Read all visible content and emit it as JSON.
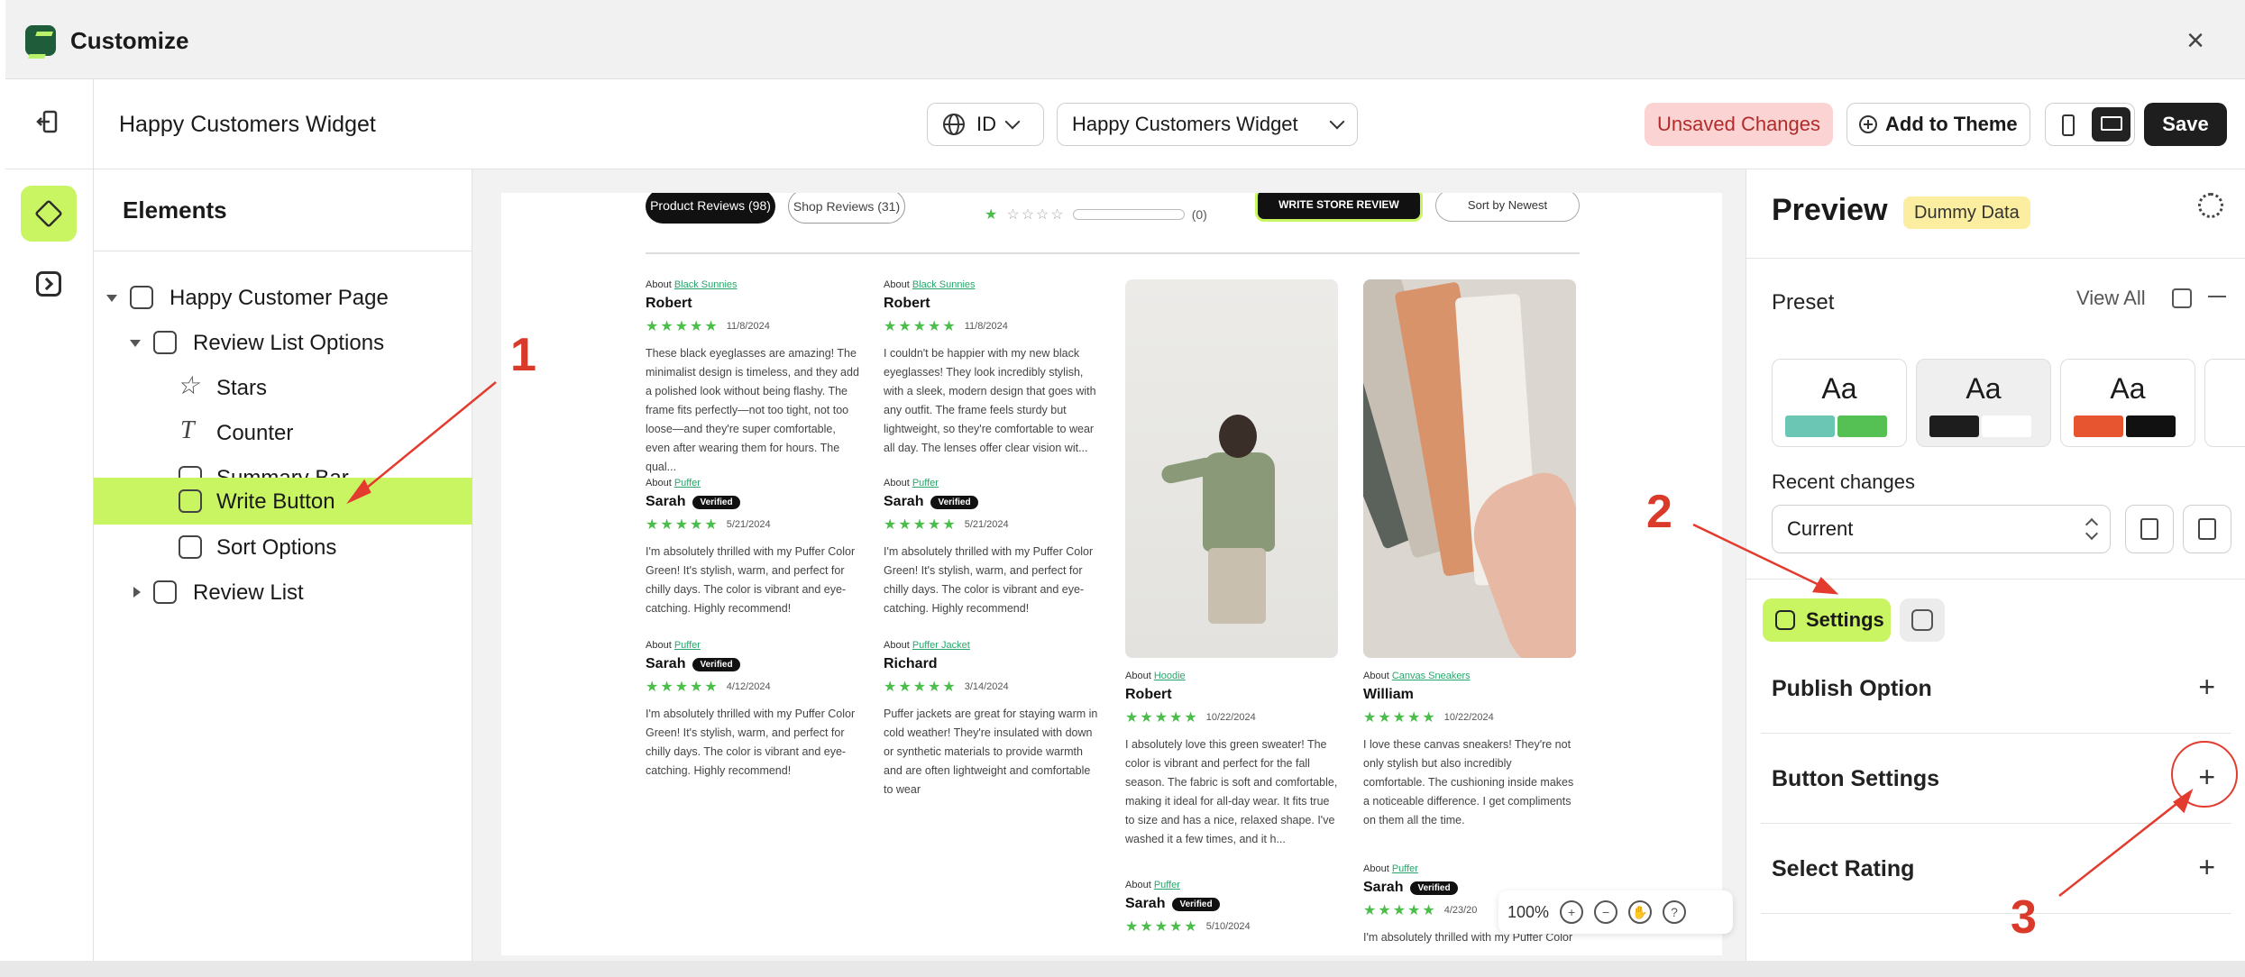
{
  "window": {
    "title": "Customize"
  },
  "header": {
    "page_name": "Happy Customers Widget",
    "language": "ID",
    "widget_select": "Happy Customers Widget",
    "unsaved": "Unsaved Changes",
    "add_to_theme": "Add to Theme",
    "save": "Save"
  },
  "elements": {
    "title": "Elements",
    "tree": [
      {
        "label": "Happy Customer Page"
      },
      {
        "label": "Review List Options"
      },
      {
        "label": "Stars"
      },
      {
        "label": "Counter"
      },
      {
        "label": "Summary Bar"
      },
      {
        "label": "Write Button"
      },
      {
        "label": "Sort Options"
      },
      {
        "label": "Review List"
      }
    ]
  },
  "preview_page": {
    "tab_product": "Product Reviews (98)",
    "tab_shop": "Shop Reviews (31)",
    "rating_count": "(0)",
    "write_store": "WRITE STORE REVIEW",
    "sort": "Sort by Newest",
    "verified": "Verified",
    "reviews": [
      {
        "about": "About",
        "product": "Black Sunnies",
        "name": "Robert",
        "date": "11/8/2024",
        "text": "These black eyeglasses are amazing! The minimalist design is timeless, and they add a polished look without being flashy. The frame fits perfectly—not too tight, not too loose—and they're super comfortable, even after wearing them for hours. The qual..."
      },
      {
        "about": "About",
        "product": "Black Sunnies",
        "name": "Robert",
        "date": "11/8/2024",
        "text": "I couldn't be happier with my new black eyeglasses! They look incredibly stylish, with a sleek, modern design that goes with any outfit. The frame feels sturdy but lightweight, so they're comfortable to wear all day. The lenses offer clear vision wit..."
      },
      {
        "about": "About",
        "product": "Puffer",
        "name": "Sarah",
        "date": "5/21/2024",
        "text": "I'm absolutely thrilled with my Puffer Color Green! It's stylish, warm, and perfect for chilly days. The color is vibrant and eye-catching. Highly recommend!"
      },
      {
        "about": "About",
        "product": "Puffer",
        "name": "Sarah",
        "date": "5/21/2024",
        "text": "I'm absolutely thrilled with my Puffer Color Green! It's stylish, warm, and perfect for chilly days. The color is vibrant and eye-catching. Highly recommend!"
      },
      {
        "about": "About",
        "product": "Puffer",
        "name": "Sarah",
        "date": "4/12/2024",
        "text": "I'm absolutely thrilled with my Puffer Color Green! It's stylish, warm, and perfect for chilly days. The color is vibrant and eye-catching. Highly recommend!"
      },
      {
        "about": "About",
        "product": "Puffer Jacket",
        "name": "Richard",
        "date": "3/14/2024",
        "text": "Puffer jackets are great for staying warm in cold weather! They're insulated with down or synthetic materials to provide warmth and are often lightweight and comfortable to wear"
      },
      {
        "about": "About",
        "product": "Hoodie",
        "name": "Robert",
        "date": "10/22/2024",
        "text": "I absolutely love this green sweater! The color is vibrant and perfect for the fall season. The fabric is soft and comfortable, making it ideal for all-day wear. It fits true to size and has a nice, relaxed shape. I've washed it a few times, and it h..."
      },
      {
        "about": "About",
        "product": "Canvas Sneakers",
        "name": "William",
        "date": "10/22/2024",
        "text": "I love these canvas sneakers! They're not only stylish but also incredibly comfortable. The cushioning inside makes a noticeable difference. I get compliments on them all the time."
      },
      {
        "about": "About",
        "product": "Puffer",
        "name": "Sarah",
        "date": "5/10/2024",
        "text": ""
      },
      {
        "about": "About",
        "product": "Puffer",
        "name": "Sarah",
        "date": "4/23/20",
        "text": "I'm absolutely thrilled with my Puffer Color"
      }
    ],
    "zoom": "100%"
  },
  "right_panel": {
    "title": "Preview",
    "badge": "Dummy Data",
    "preset_label": "Preset",
    "view_all": "View All",
    "preset_aa": "Aa",
    "recent_label": "Recent changes",
    "recent_value": "Current",
    "settings_tab": "Settings",
    "accordions": [
      {
        "label": "Publish Option"
      },
      {
        "label": "Button Settings"
      },
      {
        "label": "Select Rating"
      }
    ]
  },
  "annotations": {
    "n1": "1",
    "n2": "2",
    "n3": "3"
  },
  "colors": {
    "accent_green": "#c9f562",
    "unsaved_bg": "#fbd3d3",
    "annotation_red": "#e33b2e",
    "star_green": "#4bbd4b"
  }
}
